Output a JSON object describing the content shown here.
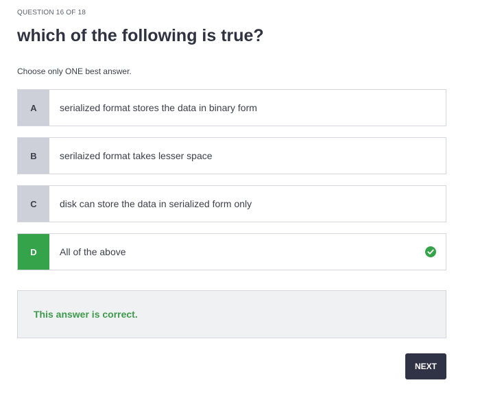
{
  "quiz": {
    "counter": "QUESTION 16 OF 18",
    "question": "which of the following is true?",
    "instruction": "Choose only ONE best answer."
  },
  "options": [
    {
      "letter": "A",
      "text": "serialized format stores the data in binary form",
      "state": "default"
    },
    {
      "letter": "B",
      "text": "serilaized format takes lesser space",
      "state": "default"
    },
    {
      "letter": "C",
      "text": "disk can store the data in serialized form only",
      "state": "default"
    },
    {
      "letter": "D",
      "text": "All of the above",
      "state": "correct",
      "icon": "check-circle-icon"
    }
  ],
  "feedback": {
    "text": "This answer is correct."
  },
  "actions": {
    "next_label": "NEXT"
  },
  "colors": {
    "correct": "#34a34a",
    "letter_bg": "#cdd0d8",
    "button_bg": "#2f3345",
    "feedback_text": "#3e9a4b"
  }
}
